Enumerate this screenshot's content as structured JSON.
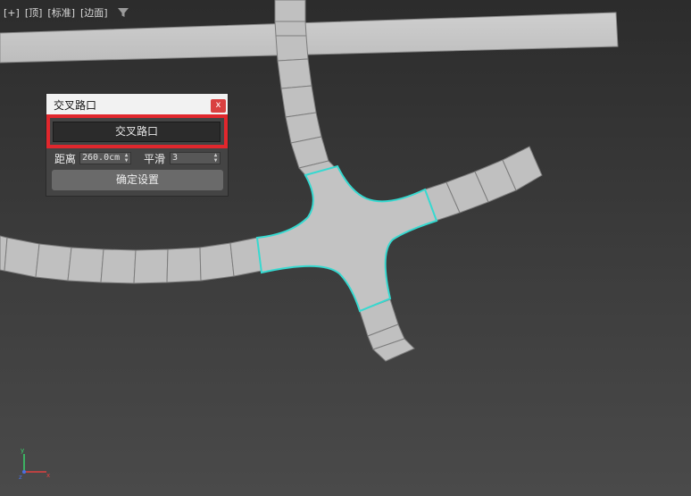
{
  "viewport": {
    "labels": [
      "[+]",
      "[顶]",
      "[标准]",
      "[边面]"
    ],
    "filter_icon": "filter-icon"
  },
  "dialog": {
    "title": "交叉路口",
    "close_label": "x",
    "junction_button_label": "交叉路口",
    "distance_label": "距离",
    "distance_value": "260.0cm",
    "smooth_label": "平滑",
    "smooth_value": "3",
    "confirm_button_label": "确定设置"
  },
  "axis_gizmo": {
    "y_label": "y",
    "x_label": "x",
    "z_label": "z"
  },
  "colors": {
    "road_fill": "#c2c2c2",
    "road_edge": "#7d7d7d",
    "selection_outline": "#36d9d0",
    "highlight": "#e1272d",
    "dialog_bg": "#444444"
  }
}
